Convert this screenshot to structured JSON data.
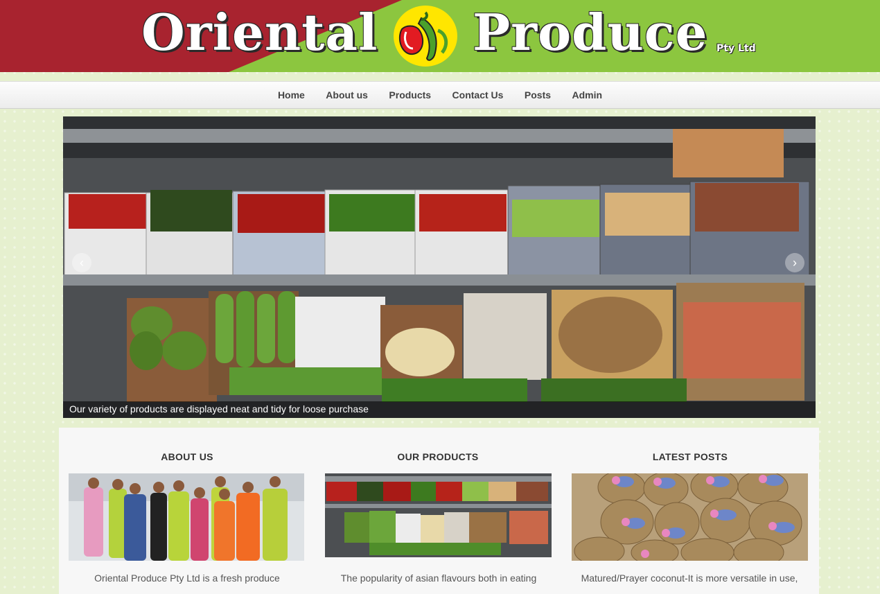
{
  "header": {
    "logo_left": "Oriental",
    "logo_right": "Produce",
    "logo_suffix": "Pty Ltd"
  },
  "nav": {
    "items": [
      "Home",
      "About us",
      "Products",
      "Contact Us",
      "Posts",
      "Admin"
    ]
  },
  "slider": {
    "caption": "Our variety of products are displayed neat and tidy for loose purchase",
    "prev_icon": "chevron-left-icon",
    "next_icon": "chevron-right-icon"
  },
  "columns": [
    {
      "title": "ABOUT US",
      "text": "Oriental Produce Pty Ltd is a fresh produce"
    },
    {
      "title": "OUR PRODUCTS",
      "text": "The popularity of asian flavours both in eating"
    },
    {
      "title": "LATEST POSTS",
      "text": "Matured/Prayer coconut-It is more versatile in use,"
    }
  ],
  "colors": {
    "banner_green": "#8cc63f",
    "banner_red": "#a8232f",
    "page_bg": "#e6f0cf"
  }
}
